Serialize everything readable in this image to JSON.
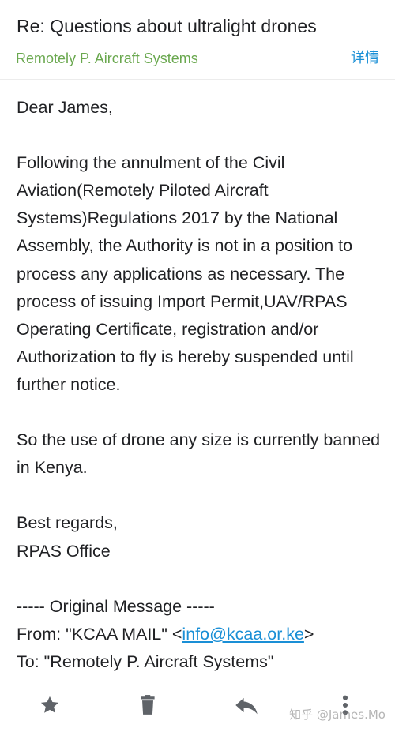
{
  "header": {
    "subject": "Re: Questions about ultralight drones",
    "sender": "Remotely P. Aircraft Systems",
    "details_label": "详情"
  },
  "body": {
    "greeting": "Dear James,",
    "paragraph1": "Following the annulment of the Civil Aviation(Remotely Piloted Aircraft Systems)Regulations 2017 by the National Assembly, the Authority is not in a position to process any applications as necessary. The process of issuing Import Permit,UAV/RPAS Operating Certificate, registration and/or Authorization to fly is hereby suspended until further notice.",
    "paragraph2": "So the use of drone any size  is currently banned in Kenya.",
    "closing": "Best regards,",
    "signature": "RPAS Office",
    "original_message": "----- Original Message -----",
    "from_prefix": "From: \"KCAA MAIL\" <",
    "from_email": "info@kcaa.or.ke",
    "from_suffix": ">",
    "to_line": "To: \"Remotely P. Aircraft Systems\""
  },
  "toolbar": {
    "items": [
      {
        "icon": "star-icon"
      },
      {
        "icon": "trash-icon"
      },
      {
        "icon": "reply-icon"
      },
      {
        "icon": "more-vertical-icon"
      }
    ]
  },
  "watermark": "知乎 @James.Mo",
  "colors": {
    "sender": "#6aa84f",
    "link": "#1a8fd6",
    "text": "#202124",
    "icon": "#5f6368"
  }
}
